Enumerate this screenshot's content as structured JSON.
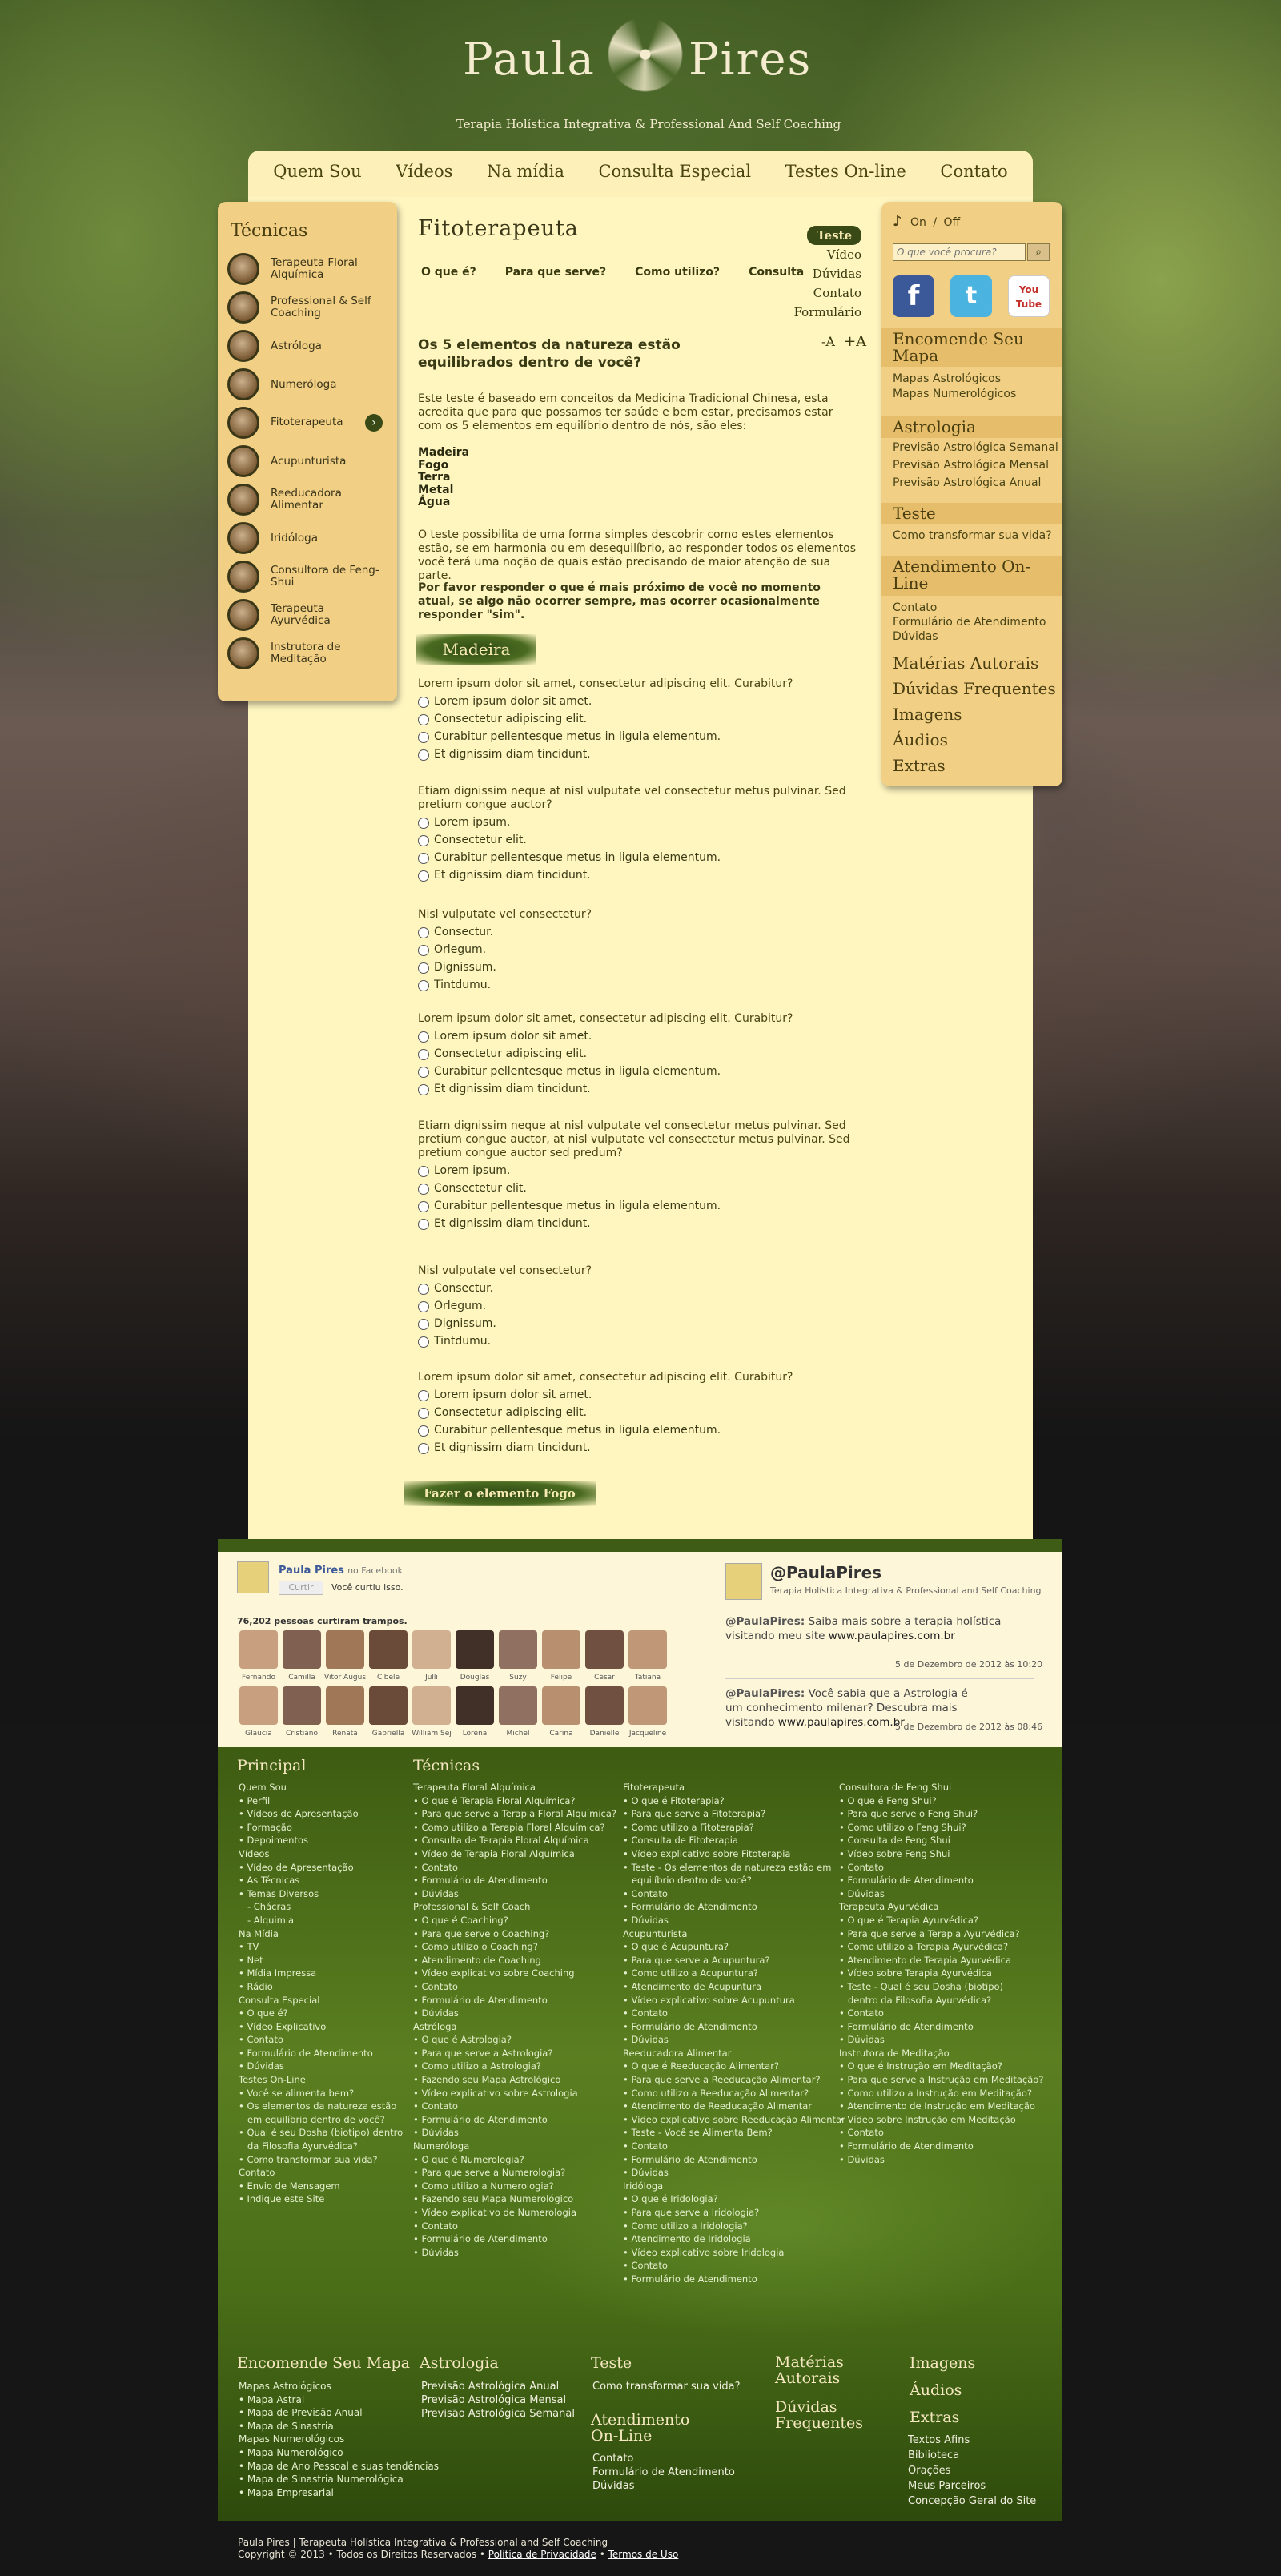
{
  "header": {
    "logo_left": "Paula",
    "logo_right": "Pires",
    "tagline": "Terapia Holística Integrativa  &  Professional And Self Coaching"
  },
  "nav": [
    "Quem Sou",
    "Vídeos",
    "Na mídia",
    "Consulta Especial",
    "Testes On-line",
    "Contato"
  ],
  "left": {
    "title": "Técnicas",
    "items": [
      "Terapeuta Floral Alquímica",
      "Professional & Self Coaching",
      "Astróloga",
      "Numeróloga",
      "Fitoterapeuta",
      "Acupunturista",
      "Reeducadora Alimentar",
      "Iridóloga",
      "Consultora de Feng-Shui",
      "Terapeuta Ayurvédica",
      "Instrutora de Meditação"
    ]
  },
  "right": {
    "sound_on": "On",
    "sound_sep": "/",
    "sound_off": "Off",
    "search_placeholder": "O que você procura?",
    "social": [
      "f",
      "t",
      "You Tube"
    ],
    "mapa_title": "Encomende Seu Mapa",
    "mapa_links": [
      "Mapas Astrológicos",
      "Mapas Numerológicos"
    ],
    "astro_title": "Astrologia",
    "astro_links": [
      "Previsão Astrológica Semanal",
      "Previsão Astrológica Mensal",
      "Previsão Astrológica Anual"
    ],
    "teste_title": "Teste",
    "teste_links": [
      "Como transformar sua vida?"
    ],
    "atend_title": "Atendimento On-Line",
    "atend_links": [
      "Contato",
      "Formulário de Atendimento",
      "Dúvidas"
    ],
    "big_links": [
      "Matérias Autorais",
      "Dúvidas Frequentes",
      "Imagens",
      "Áudios",
      "Extras"
    ]
  },
  "main": {
    "title": "Fitoterapeuta",
    "subnav": [
      "O que é?",
      "Para que serve?",
      "Como utilizo?",
      "Consulta"
    ],
    "tabs": [
      "Teste",
      "Vídeo",
      "Dúvidas",
      "Contato",
      "Formulário"
    ],
    "font_minus": "-A",
    "font_plus": "+A",
    "heading": "Os 5 elementos da natureza estão equilibrados dentro de você?",
    "intro": "Este teste é baseado em conceitos da Medicina Tradicional Chinesa, esta acredita que para que possamos ter saúde e bem estar, precisamos estar com os 5 elementos em equilíbrio dentro de nós, são eles:",
    "elements": [
      "Madeira",
      "Fogo",
      "Terra",
      "Metal",
      "Água"
    ],
    "p2": "O teste possibilita de uma forma simples descobrir como estes elementos estão, se em harmonia ou em desequilíbrio, ao responder todos os elementos você terá uma noção de quais estão precisando de maior atenção de sua parte.",
    "p3": "Por favor responder o que é mais próximo de você no momento atual, se algo não ocorrer sempre, mas ocorrer ocasionalmente responder \"sim\".",
    "section": "Madeira",
    "questions": [
      {
        "q": "Lorem ipsum dolor sit amet, consectetur adipiscing elit. Curabitur?",
        "o": [
          "Lorem ipsum dolor sit amet.",
          "Consectetur adipiscing elit.",
          "Curabitur pellentesque metus in ligula elementum.",
          "Et dignissim diam tincidunt."
        ]
      },
      {
        "q": "Etiam dignissim neque at nisl vulputate vel consectetur metus pulvinar. Sed pretium congue auctor?",
        "o": [
          "Lorem ipsum.",
          "Consectetur elit.",
          "Curabitur pellentesque metus in ligula elementum.",
          "Et dignissim diam tincidunt."
        ]
      },
      {
        "q": "Nisl vulputate vel consectetur?",
        "o": [
          "Consectur.",
          "Orlegum.",
          "Dignissum.",
          "Tintdumu."
        ]
      },
      {
        "q": "Lorem ipsum dolor sit amet, consectetur adipiscing elit. Curabitur?",
        "o": [
          "Lorem ipsum dolor sit amet.",
          "Consectetur adipiscing elit.",
          "Curabitur pellentesque metus in ligula elementum.",
          "Et dignissim diam tincidunt."
        ]
      },
      {
        "q": "Etiam dignissim neque at nisl vulputate vel consectetur metus pulvinar. Sed pretium congue auctor, at nisl vulputate vel consectetur metus pulvinar. Sed pretium congue auctor sed predum?",
        "o": [
          "Lorem ipsum.",
          "Consectetur elit.",
          "Curabitur pellentesque metus in ligula elementum.",
          "Et dignissim diam tincidunt."
        ]
      },
      {
        "q": "Nisl vulputate vel consectetur?",
        "o": [
          "Consectur.",
          "Orlegum.",
          "Dignissum.",
          "Tintdumu."
        ]
      },
      {
        "q": "Lorem ipsum dolor sit amet, consectetur adipiscing elit. Curabitur?",
        "o": [
          "Lorem ipsum dolor sit amet.",
          "Consectetur adipiscing elit.",
          "Curabitur pellentesque metus in ligula elementum.",
          "Et dignissim diam tincidunt."
        ]
      }
    ],
    "next_button": "Fazer o elemento Fogo"
  },
  "facebook": {
    "page": "Paula Pires",
    "on": "no Facebook",
    "like": "Curtir",
    "you_liked": "Você curtiu isso.",
    "count": "76,202 pessoas curtiram trampos.",
    "people": [
      "Fernando",
      "Camilla",
      "Vitor Augus",
      "Cibele",
      "Julli",
      "Douglas",
      "Suzy",
      "Felipe",
      "César",
      "Tatiana",
      "Glaucia",
      "Cristiano",
      "Renata",
      "Gabriella",
      "William Sej",
      "Lorena",
      "Michel",
      "Carina",
      "Danielle",
      "Jacqueline"
    ]
  },
  "twitter": {
    "handle": "@PaulaPires",
    "bio": "Terapia Holística Integrativa & Professional and Self Coaching",
    "t1_user": "@PaulaPires:",
    "t1": "Saiba mais sobre a terapia holística visitando meu site",
    "t1_link": "www.paulapires.com.br",
    "t1_date": "5 de Dezembro de 2012 às 10:20",
    "t2_user": "@PaulaPires:",
    "t2": "Você sabia que a Astrologia é um conhecimento milenar? Descubra mais visitando",
    "t2_link": "www.paulapires.com.br",
    "t2_date": "5 de Dezembro de 2012 às 08:46"
  },
  "footer": {
    "principal_title": "Principal",
    "principal": "Quem Sou\n• Perfil\n• Vídeos de Apresentação\n• Formação\n• Depoimentos\nVídeos\n• Vídeo de Apresentação\n• As Técnicas\n• Temas Diversos\n   - Chácras\n   - Alquimia\nNa Mídia\n• TV\n• Net\n• Mídia Impressa\n• Rádio\nConsulta Especial\n• O que é?\n• Vídeo Explicativo\n• Contato\n• Formulário de Atendimento\n• Dúvidas\nTestes On-Line\n• Você se alimenta bem?\n• Os elementos da natureza estão\n   em equilíbrio dentro de você?\n• Qual é seu Dosha (biotipo) dentro\n   da Filosofia Ayurvédica?\n• Como transformar sua vida?\nContato\n• Envio de Mensagem\n• Indique este Site",
    "tecnicas_title": "Técnicas",
    "col2": "Terapeuta Floral Alquímica\n• O que é Terapia Floral Alquímica?\n• Para que serve a Terapia Floral Alquímica?\n• Como utilizo a Terapia Floral Alquímica?\n• Consulta de Terapia Floral Alquímica\n• Vídeo de Terapia Floral Alquímica\n• Contato\n• Formulário de Atendimento\n• Dúvidas\nProfessional & Self Coach\n• O que é Coaching?\n• Para que serve o Coaching?\n• Como utilizo o Coaching?\n• Atendimento de Coaching\n• Vídeo explicativo sobre Coaching\n• Contato\n• Formulário de Atendimento\n• Dúvidas\nAstróloga\n• O que é Astrologia?\n• Para que serve a Astrologia?\n• Como utilizo a Astrologia?\n• Fazendo seu Mapa Astrológico\n• Vídeo explicativo sobre Astrologia\n• Contato\n• Formulário de Atendimento\n• Dúvidas\nNumeróloga\n• O que é Numerologia?\n• Para que serve a Numerologia?\n• Como utilizo a Numerologia?\n• Fazendo seu Mapa Numerológico\n• Vídeo explicativo de Numerologia\n• Contato\n• Formulário de Atendimento\n• Dúvidas",
    "col3": "Fitoterapeuta\n• O que é Fitoterapia?\n• Para que serve a Fitoterapia?\n• Como utilizo a Fitoterapia?\n• Consulta de Fitoterapia\n• Vídeo explicativo sobre Fitoterapia\n• Teste - Os elementos da natureza estão em\n   equilíbrio dentro de você?\n• Contato\n• Formulário de Atendimento\n• Dúvidas\nAcupunturista\n• O que é Acupuntura?\n• Para que serve a Acupuntura?\n• Como utilizo a Acupuntura?\n• Atendimento de Acupuntura\n• Vídeo explicativo sobre Acupuntura\n• Contato\n• Formulário de Atendimento\n• Dúvidas\nReeducadora Alimentar\n• O que é Reeducação Alimentar?\n• Para que serve a Reeducação Alimentar?\n• Como utilizo a Reeducação Alimentar?\n• Atendimento de Reeducação Alimentar\n• Vídeo explicativo sobre Reeducação Alimentar\n• Teste - Você se Alimenta Bem?\n• Contato\n• Formulário de Atendimento\n• Dúvidas\nIridóloga\n• O que é Iridologia?\n• Para que serve a Iridologia?\n• Como utilizo a Iridologia?\n• Atendimento de Iridologia\n• Vídeo explicativo sobre Iridologia\n• Contato\n• Formulário de Atendimento",
    "col4": "Consultora de Feng Shui\n• O que é Feng Shui?\n• Para que serve o Feng Shui?\n• Como utilizo o Feng Shui?\n• Consulta de Feng Shui\n• Vídeo sobre Feng Shui\n• Contato\n• Formulário de Atendimento\n• Dúvidas\nTerapeuta Ayurvédica\n• O que é Terapia Ayurvédica?\n• Para que serve a Terapia Ayurvédica?\n• Como utilizo a Terapia Ayurvédica?\n• Atendimento de Terapia Ayurvédica\n• Vídeo sobre Terapia Ayurvédica\n• Teste - Qual é seu Dosha (biotipo)\n   dentro da Filosofia Ayurvédica?\n• Contato\n• Formulário de Atendimento\n• Dúvidas\nInstrutora de Meditação\n• O que é Instrução em Meditação?\n• Para que serve a Instrução em Meditação?\n• Como utilizo a Instrução em Meditação?\n• Atendimento de Instrução em Meditação\n• Vídeo sobre Instrução em Meditação\n• Contato\n• Formulário de Atendimento\n• Dúvidas",
    "mapa_title": "Encomende Seu Mapa",
    "mapa": "Mapas Astrológicos\n• Mapa Astral\n• Mapa de Previsão Anual\n• Mapa de Sinastria\nMapas Numerológicos\n• Mapa Numerológico\n• Mapa de Ano Pessoal e suas tendências\n• Mapa de Sinastria Numerológica\n• Mapa Empresarial",
    "astro_title": "Astrologia",
    "astro": "Previsão Astrológica Anual\nPrevisão Astrológica Mensal\nPrevisão Astrológica Semanal",
    "teste_title": "Teste",
    "teste": "Como transformar sua vida?",
    "atend_title": "Atendimento On-Line",
    "atend": "Contato\nFormulário de Atendimento\nDúvidas",
    "materias": "Matérias Autorais",
    "duvidas": "Dúvidas Frequentes",
    "imagens": "Imagens",
    "audios": "Áudios",
    "extras": "Extras",
    "extras_links": "Textos Afins\nBiblioteca\nOrações\nMeus Parceiros\nConcepção Geral do Site"
  },
  "copyright": {
    "line1": "Paula Pires | Terapeuta Holística Integrativa & Professional and Self Coaching",
    "line2": "Copyright © 2013 • Todos os Direitos Reservados •",
    "privacy": "Política de Privacidade",
    "sep": "•",
    "terms": "Termos de Uso"
  }
}
